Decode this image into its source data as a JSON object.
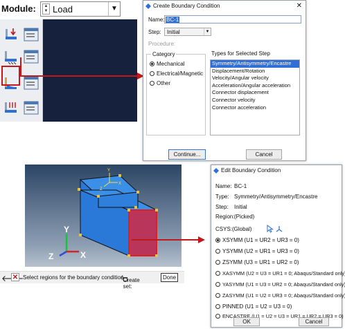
{
  "module": {
    "label": "Module:",
    "value": "Load"
  },
  "toolbox": {
    "tools": [
      "create-load-icon",
      "load-manager-icon",
      "create-boundary-condition-icon",
      "boundary-condition-manager-icon",
      "create-predefined-field-icon",
      "predefined-field-manager-icon",
      "create-load-case-icon",
      "load-case-manager-icon"
    ]
  },
  "create_dialog": {
    "title": "Create Boundary Condition",
    "name_label": "Name:",
    "name_value": "BC-1",
    "step_label": "Step:",
    "step_value": "Initial",
    "procedure_label": "Procedure:",
    "category_title": "Category",
    "categories": [
      {
        "label": "Mechanical",
        "selected": true
      },
      {
        "label": "Electrical/Magnetic",
        "selected": false
      },
      {
        "label": "Other",
        "selected": false
      }
    ],
    "types_title": "Types for Selected Step",
    "types": [
      {
        "label": "Symmetry/Antisymmetry/Encastre",
        "selected": true
      },
      {
        "label": "Displacement/Rotation",
        "selected": false
      },
      {
        "label": "Velocity/Angular velocity",
        "selected": false
      },
      {
        "label": "Acceleration/Angular acceleration",
        "selected": false
      },
      {
        "label": "Connector displacement",
        "selected": false
      },
      {
        "label": "Connector velocity",
        "selected": false
      },
      {
        "label": "Connector acceleration",
        "selected": false
      }
    ],
    "continue_label": "Continue...",
    "cancel_label": "Cancel"
  },
  "edit_dialog": {
    "title": "Edit Boundary Condition",
    "name_label": "Name:",
    "name_value": "BC-1",
    "type_label": "Type:",
    "type_value": "Symmetry/Antisymmetry/Encastre",
    "step_label": "Step:",
    "step_value": "Initial",
    "region_label": "Region:",
    "region_value": "(Picked)",
    "csys_label": "CSYS:",
    "csys_value": "(Global)",
    "options": [
      {
        "label": "XSYMM (U1 = UR2 = UR3 = 0)",
        "selected": true
      },
      {
        "label": "YSYMM (U2 = UR1 = UR3 = 0)",
        "selected": false
      },
      {
        "label": "ZSYMM (U3 = UR1 = UR2 = 0)",
        "selected": false
      },
      {
        "label": "XASYMM (U2 = U3 = UR1 = 0; Abaqus/Standard only)",
        "selected": false
      },
      {
        "label": "YASYMM (U1 = U3 = UR2 = 0; Abaqus/Standard only)",
        "selected": false
      },
      {
        "label": "ZASYMM (U1 = U2 = UR3 = 0; Abaqus/Standard only)",
        "selected": false
      },
      {
        "label": "PINNED (U1 = U2 = U3 = 0)",
        "selected": false
      },
      {
        "label": "ENCASTRE (U1 = U2 = U3 = UR1 = UR2 = UR3 = 0)",
        "selected": false
      }
    ],
    "ok_label": "OK",
    "cancel_label": "Cancel"
  },
  "viewport": {
    "triad": {
      "x": "X",
      "y": "Y",
      "z": "Z"
    },
    "model_triad": {
      "x": "X",
      "y": "Y",
      "z": "Z"
    }
  },
  "prompt": {
    "text": "Select regions for the boundary condition",
    "create_set_label": "Create set:",
    "done_label": "Done"
  },
  "colors": {
    "accent_red": "#c0181b",
    "part_blue": "#2a78d8",
    "selection_blue": "#2f6fd6"
  }
}
